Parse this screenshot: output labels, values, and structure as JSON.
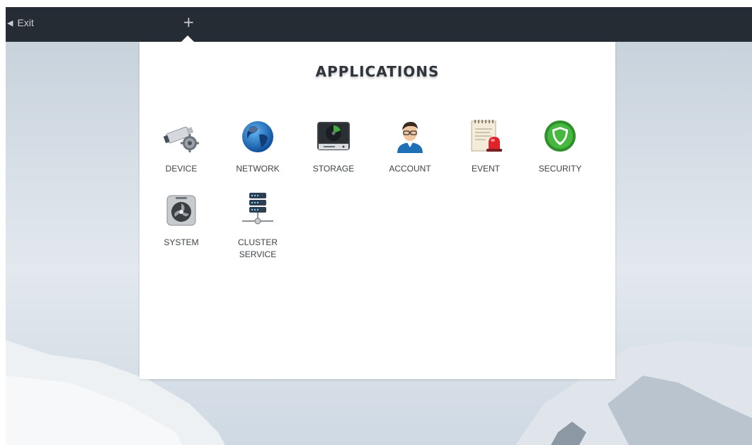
{
  "topbar": {
    "exit_label": "Exit",
    "exit_icon": "arrow-left-icon",
    "add_icon": "plus-icon",
    "add_label": "+"
  },
  "panel": {
    "title": "APPLICATIONS"
  },
  "apps": [
    {
      "label": "DEVICE",
      "icon": "camera-gear-icon"
    },
    {
      "label": "NETWORK",
      "icon": "globe-icon"
    },
    {
      "label": "STORAGE",
      "icon": "hard-drive-icon"
    },
    {
      "label": "ACCOUNT",
      "icon": "user-avatar-icon"
    },
    {
      "label": "EVENT",
      "icon": "notepad-alarm-icon"
    },
    {
      "label": "SECURITY",
      "icon": "shield-icon"
    },
    {
      "label": "SYSTEM",
      "icon": "system-fan-icon"
    },
    {
      "label": "CLUSTER\nSERVICE",
      "icon": "server-stack-icon"
    }
  ],
  "colors": {
    "topbar": "#262c33",
    "panel": "#ffffff",
    "security_green": "#3fae3a",
    "network_blue": "#1d6fc4",
    "event_red": "#e0232b"
  }
}
